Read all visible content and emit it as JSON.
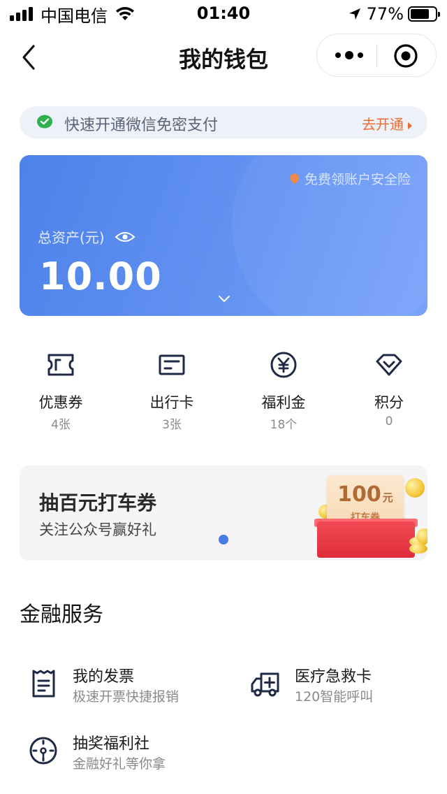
{
  "status_bar": {
    "carrier": "中国电信",
    "time": "01:40",
    "battery": "77%"
  },
  "nav": {
    "title": "我的钱包"
  },
  "pay_banner": {
    "text": "快速开通微信免密支付",
    "action": "去开通"
  },
  "assets_card": {
    "insurance": "免费领账户安全险",
    "label": "总资产(元)",
    "value": "10.00"
  },
  "quick_items": [
    {
      "label": "优惠券",
      "count": "4张",
      "icon": "ticket-icon"
    },
    {
      "label": "出行卡",
      "count": "3张",
      "icon": "card-icon"
    },
    {
      "label": "福利金",
      "count": "18个",
      "icon": "yuan-coin-icon"
    },
    {
      "label": "积分",
      "count": "0",
      "icon": "diamond-icon"
    }
  ],
  "promo": {
    "title": "抽百元打车券",
    "subtitle": "关注公众号赢好礼",
    "coupon_value": "100",
    "coupon_unit": "元",
    "coupon_label": "打车券"
  },
  "finance": {
    "title": "金融服务",
    "items": [
      {
        "title": "我的发票",
        "subtitle": "极速开票快捷报销",
        "icon": "invoice-icon"
      },
      {
        "title": "医疗急救卡",
        "subtitle": "120智能呼叫",
        "icon": "ambulance-icon"
      },
      {
        "title": "抽奖福利社",
        "subtitle": "金融好礼等你拿",
        "icon": "lottery-dial-icon"
      }
    ]
  },
  "colors": {
    "accent_blue": "#4d82ea",
    "action_orange": "#ee6b2d",
    "wechat_green": "#2bb24c"
  }
}
